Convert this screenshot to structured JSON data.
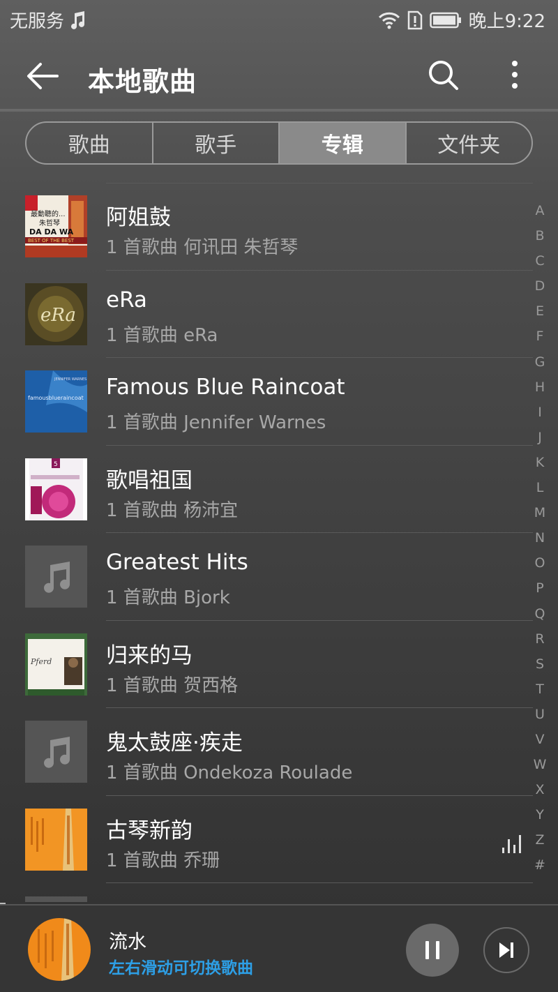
{
  "status_bar": {
    "carrier": "无服务",
    "music_icon": "music-note-icon",
    "time": "晚上9:22",
    "icons": [
      "wifi-icon",
      "sim-alert-icon",
      "battery-icon"
    ]
  },
  "header": {
    "title": "本地歌曲",
    "back_icon": "back-arrow-icon",
    "search_icon": "search-icon",
    "more_icon": "more-vertical-icon"
  },
  "tabs": [
    {
      "label": "歌曲",
      "active": false
    },
    {
      "label": "歌手",
      "active": false
    },
    {
      "label": "专辑",
      "active": true
    },
    {
      "label": "文件夹",
      "active": false
    }
  ],
  "albums": [
    {
      "title": "阿姐鼓",
      "subtitle": "1 首歌曲 何讯田 朱哲琴",
      "cover": "art",
      "cover_text": [
        "最動聽的...",
        "朱哲琴",
        "DA DA WA",
        "BEST OF THE BEST"
      ]
    },
    {
      "title": "eRa",
      "subtitle": "1 首歌曲 eRa",
      "cover": "art",
      "cover_text": [
        "eRa"
      ]
    },
    {
      "title": "Famous Blue Raincoat",
      "subtitle": "1 首歌曲 Jennifer Warnes",
      "cover": "art",
      "cover_text": [
        "JENNIFER WARNES",
        "famousblueraincoat"
      ]
    },
    {
      "title": "歌唱祖国",
      "subtitle": "1 首歌曲 杨沛宜",
      "cover": "art",
      "cover_text": [
        "5"
      ]
    },
    {
      "title": "Greatest Hits",
      "subtitle": "1 首歌曲 Bjork",
      "cover": "placeholder"
    },
    {
      "title": "归来的马",
      "subtitle": "1 首歌曲 贺西格",
      "cover": "art",
      "cover_text": [
        "Pferd"
      ]
    },
    {
      "title": "鬼太鼓座·疾走",
      "subtitle": "1 首歌曲 Ondekoza Roulade",
      "cover": "placeholder"
    },
    {
      "title": "古琴新韵",
      "subtitle": "1 首歌曲 乔珊",
      "cover": "art",
      "cover_text": [],
      "playing": true
    }
  ],
  "index_letters": [
    "A",
    "B",
    "C",
    "D",
    "E",
    "F",
    "G",
    "H",
    "I",
    "J",
    "K",
    "L",
    "M",
    "N",
    "O",
    "P",
    "Q",
    "R",
    "S",
    "T",
    "U",
    "V",
    "W",
    "X",
    "Y",
    "Z",
    "#"
  ],
  "now_playing": {
    "title": "流水",
    "hint": "左右滑动可切换歌曲",
    "pause_icon": "pause-icon",
    "next_icon": "skip-next-icon"
  },
  "colors": {
    "accent": "#2d9fe6",
    "active_tab": "#8a8a8a",
    "background": "#3d3d3d"
  }
}
